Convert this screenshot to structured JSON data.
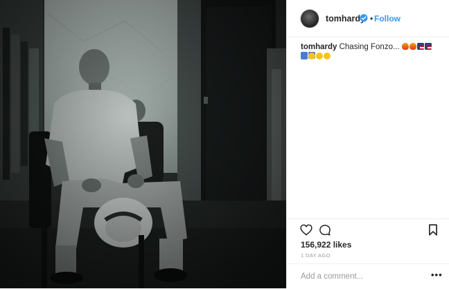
{
  "post": {
    "username": "tomhardy",
    "separator": "•",
    "follow_label": "Follow",
    "caption_username": "tomhardy",
    "caption_text": "Chasing Fonzo...",
    "caption_emoji": [
      "fire",
      "fire",
      "us-flag",
      "us-flag",
      "star",
      "star",
      "star",
      "smiling-face",
      "smiling-face",
      "smiling-face"
    ],
    "likes_text": "156,922 likes",
    "timestamp": "1 DAY AGO",
    "comment_placeholder": "Add a comment...",
    "more_label": "•••"
  },
  "colors": {
    "accent": "#3897f0",
    "verified": "#3897f0",
    "text": "#262626",
    "muted": "#999999",
    "border": "#efefef"
  },
  "icons": {
    "like": "heart-icon",
    "comment": "comment-icon",
    "save": "bookmark-icon",
    "verified": "verified-badge-icon"
  }
}
